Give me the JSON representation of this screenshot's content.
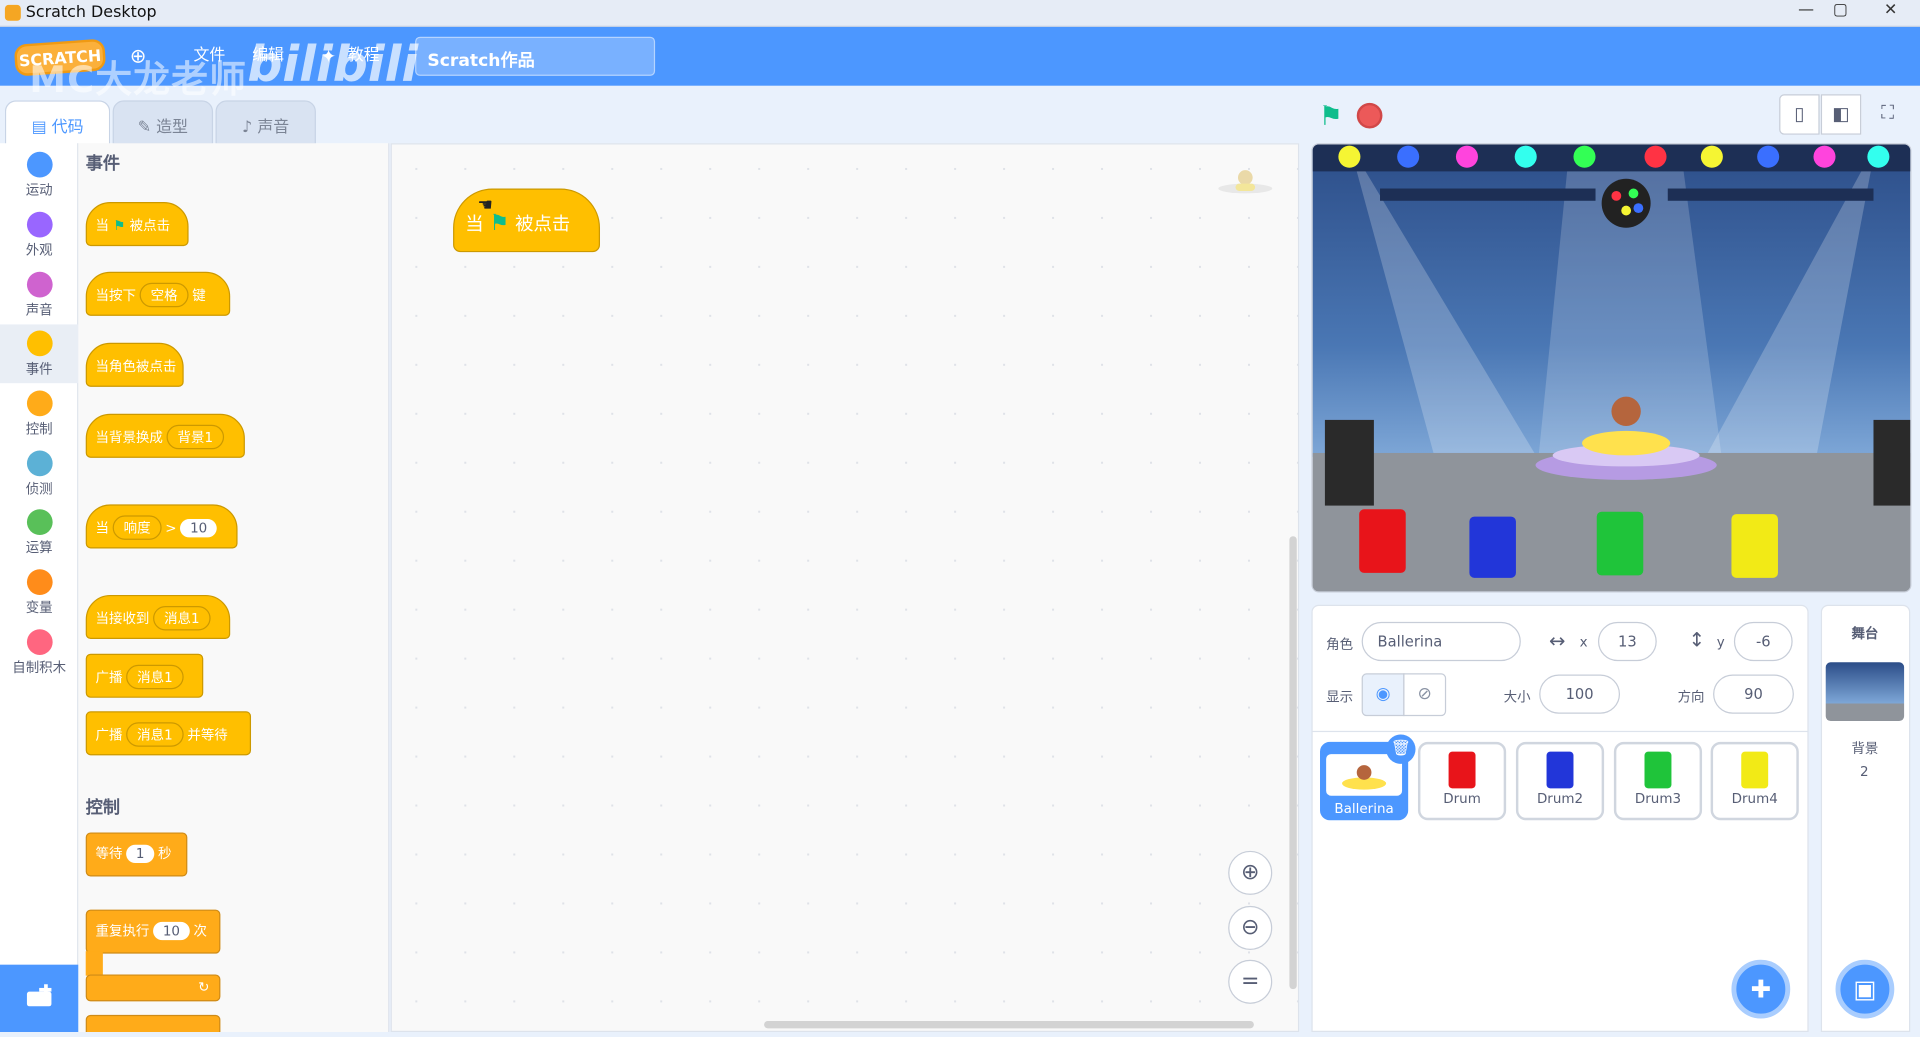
{
  "window": {
    "title": "Scratch Desktop",
    "min_label": "—",
    "max_label": "▢",
    "close_label": "✕"
  },
  "menubar": {
    "logo_text": "SCRATCH",
    "language_icon": "globe-icon",
    "file_label": "文件",
    "edit_label": "编辑",
    "tutorials_label": "教程",
    "project_title": "Scratch作品",
    "watermark_text": "MC大龙老师",
    "watermark_brand": "bilibili"
  },
  "tabs": [
    {
      "label": "代码",
      "icon": "code-icon"
    },
    {
      "label": "造型",
      "icon": "brush-icon"
    },
    {
      "label": "声音",
      "icon": "speaker-icon"
    }
  ],
  "categories": [
    {
      "label": "运动",
      "color": "#4c97ff"
    },
    {
      "label": "外观",
      "color": "#9966ff"
    },
    {
      "label": "声音",
      "color": "#cf63cf"
    },
    {
      "label": "事件",
      "color": "#ffbf00"
    },
    {
      "label": "控制",
      "color": "#ffab19"
    },
    {
      "label": "侦测",
      "color": "#5cb1d6"
    },
    {
      "label": "运算",
      "color": "#59c059"
    },
    {
      "label": "变量",
      "color": "#ff8c1a"
    },
    {
      "label": "自制积木",
      "color": "#ff6680"
    }
  ],
  "palette": {
    "events_heading": "事件",
    "control_heading": "控制",
    "b1": {
      "pre": "当",
      "post": "被点击"
    },
    "b2": {
      "pre": "当按下",
      "drop": "空格",
      "post": "键"
    },
    "b3": {
      "text": "当角色被点击"
    },
    "b4": {
      "pre": "当背景换成",
      "drop": "背景1"
    },
    "b5": {
      "pre": "当",
      "drop": "响度",
      "op": ">",
      "value": "10"
    },
    "b6": {
      "pre": "当接收到",
      "drop": "消息1"
    },
    "b7": {
      "pre": "广播",
      "drop": "消息1"
    },
    "b8": {
      "pre": "广播",
      "drop": "消息1",
      "post": "并等待"
    },
    "c1": {
      "pre": "等待",
      "value": "1",
      "post": "秒"
    },
    "c2": {
      "pre": "重复执行",
      "value": "10",
      "post": "次"
    }
  },
  "workspace": {
    "block_pre": "当",
    "block_post": "被点击"
  },
  "sprite_info": {
    "sprite_label": "角色",
    "sprite_name": "Ballerina",
    "x_label": "x",
    "x_value": "13",
    "y_label": "y",
    "y_value": "-6",
    "show_label": "显示",
    "size_label": "大小",
    "size_value": "100",
    "direction_label": "方向",
    "direction_value": "90"
  },
  "sprites": [
    {
      "name": "Ballerina",
      "color": "#ffe14d"
    },
    {
      "name": "Drum",
      "color": "#e8141a"
    },
    {
      "name": "Drum2",
      "color": "#2236d9"
    },
    {
      "name": "Drum3",
      "color": "#1fc43a"
    },
    {
      "name": "Drum4",
      "color": "#f2ea16"
    }
  ],
  "stage_panel": {
    "label": "舞台",
    "backdrops_label": "背景",
    "backdrops_count": "2"
  }
}
